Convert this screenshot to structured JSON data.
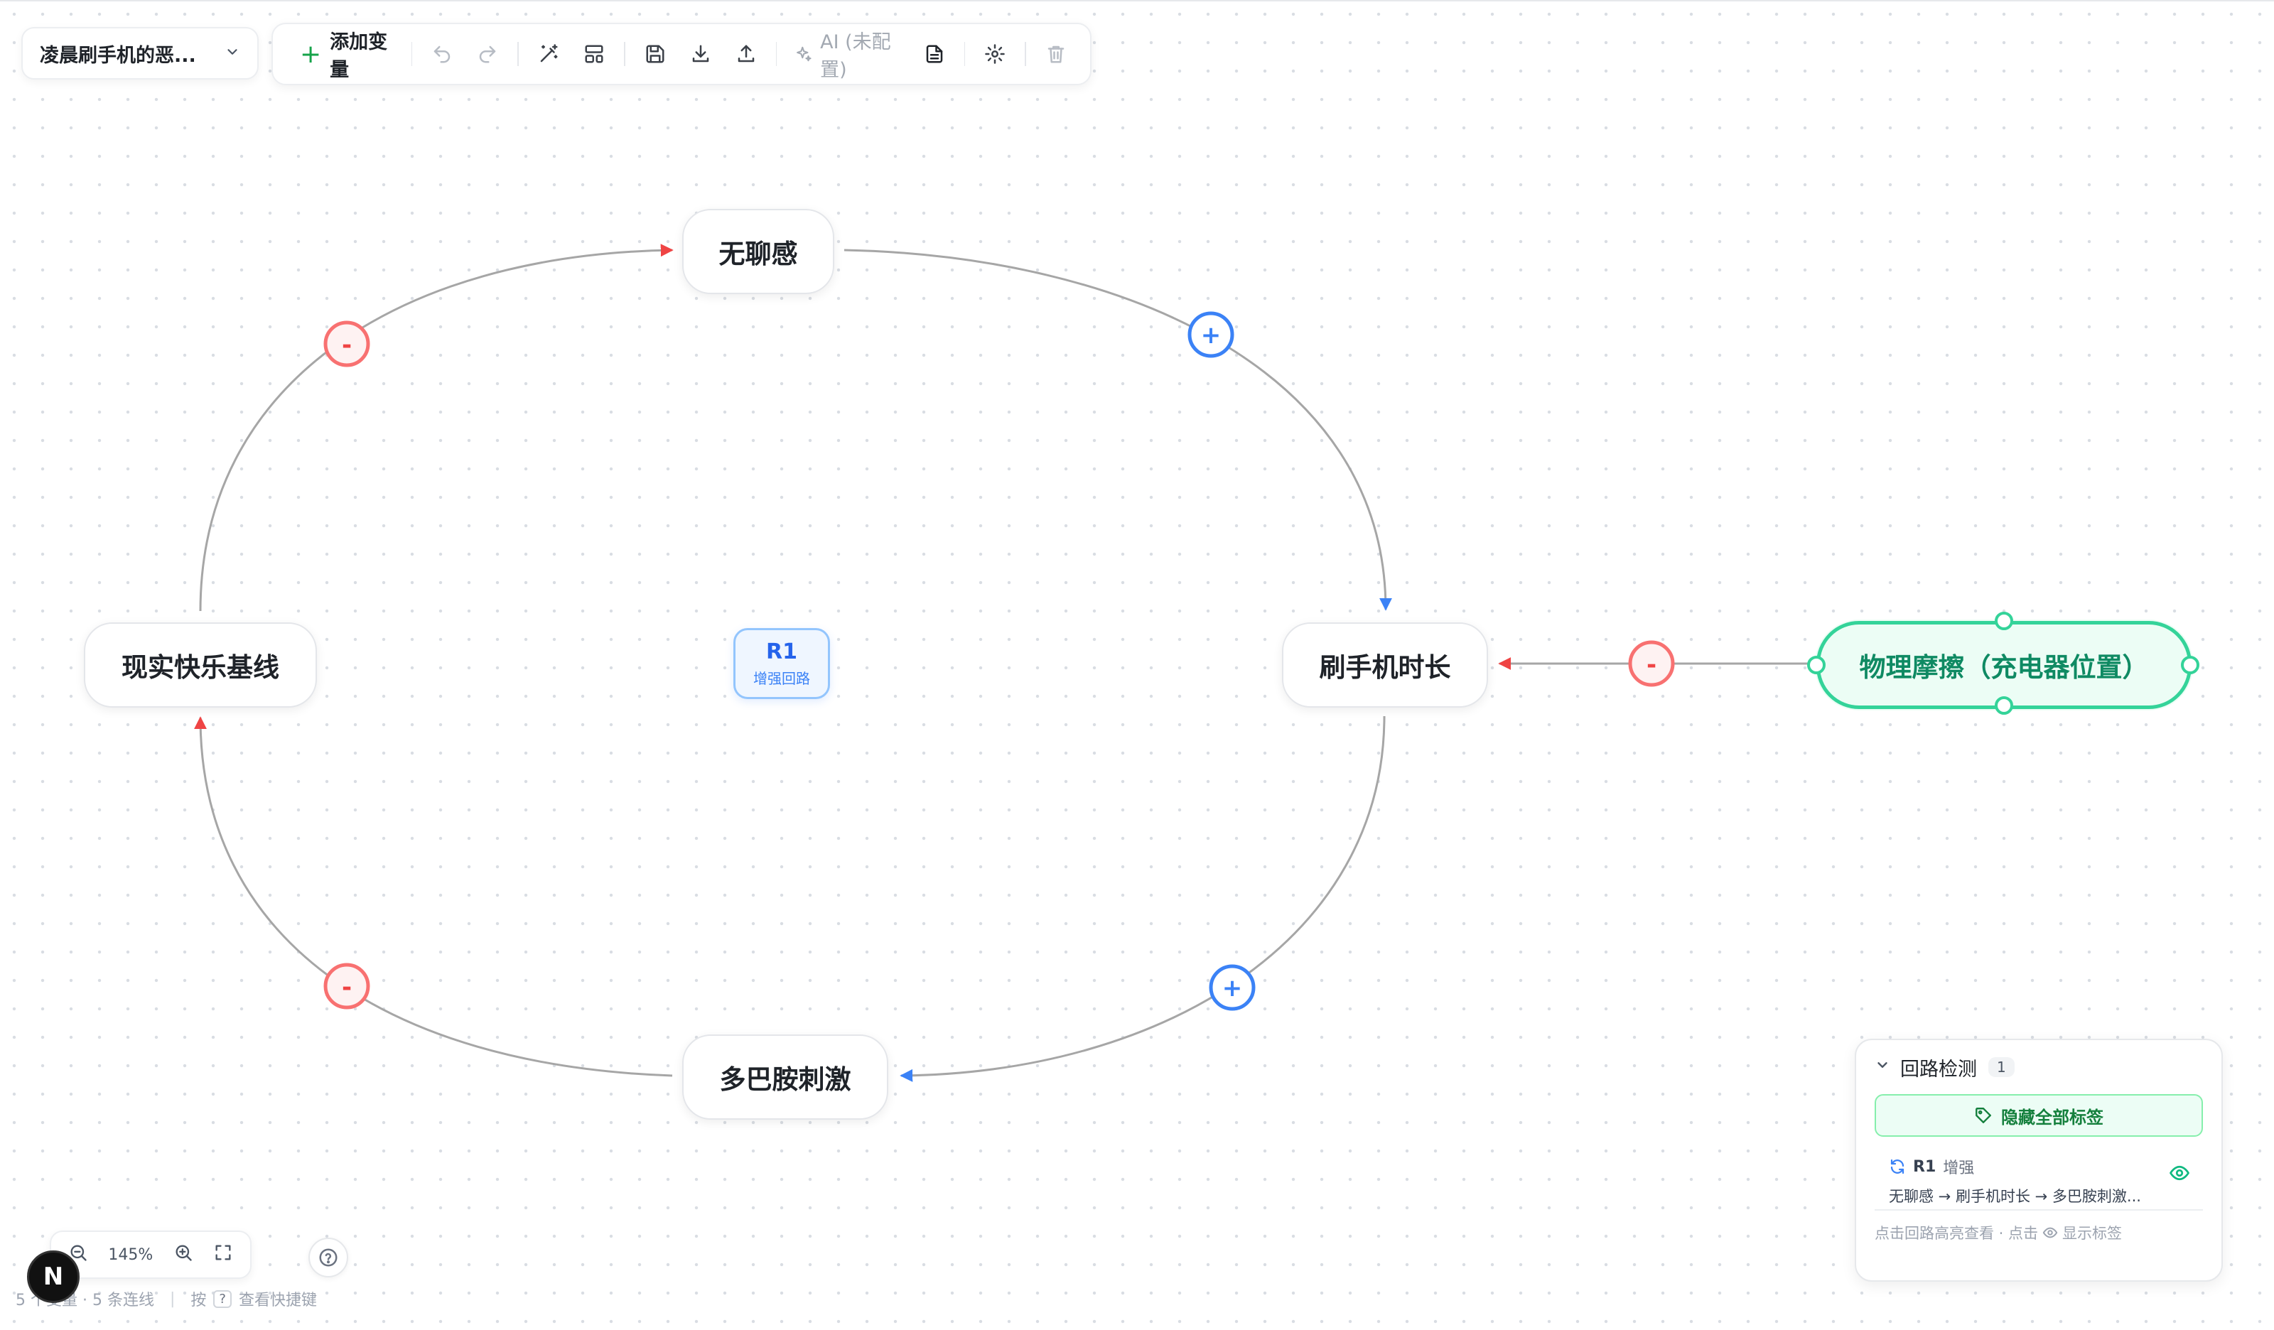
{
  "project": {
    "name": "凌晨刷手机的恶..."
  },
  "toolbar": {
    "add_variable": "添加变量",
    "ai_label": "AI (未配置)"
  },
  "nodes": [
    {
      "id": "boredom",
      "label": "无聊感"
    },
    {
      "id": "phone_time",
      "label": "刷手机时长"
    },
    {
      "id": "dopamine",
      "label": "多巴胺刺激"
    },
    {
      "id": "happiness",
      "label": "现实快乐基线"
    },
    {
      "id": "friction",
      "label": "物理摩擦（充电器位置）"
    }
  ],
  "links": [
    {
      "from": "boredom",
      "to": "phone_time",
      "polarity": "+"
    },
    {
      "from": "phone_time",
      "to": "dopamine",
      "polarity": "+"
    },
    {
      "from": "dopamine",
      "to": "happiness",
      "polarity": "-"
    },
    {
      "from": "happiness",
      "to": "boredom",
      "polarity": "-"
    },
    {
      "from": "friction",
      "to": "phone_time",
      "polarity": "-"
    }
  ],
  "loop_badge": {
    "id": "R1",
    "type": "增强回路"
  },
  "loop_panel": {
    "title": "回路检测",
    "count": "1",
    "hide_all_label": "隐藏全部标签",
    "items": [
      {
        "id": "R1",
        "type": "增强",
        "path": "无聊感 → 刷手机时长 → 多巴胺刺激..."
      }
    ],
    "footer_left": "点击回路高亮查看 · 点击",
    "footer_right": "显示标签"
  },
  "zoom": {
    "level": "145%"
  },
  "status": {
    "summary": "5 个变量 · 5 条连线",
    "hint_prefix": "按",
    "hint_key": "?",
    "hint_suffix": "查看快捷键"
  },
  "brand": {
    "letter": "N"
  },
  "colors": {
    "positive": "#3b82f6",
    "negative": "#ef4444",
    "external": "#34d399",
    "edge": "#a6a6a6"
  }
}
